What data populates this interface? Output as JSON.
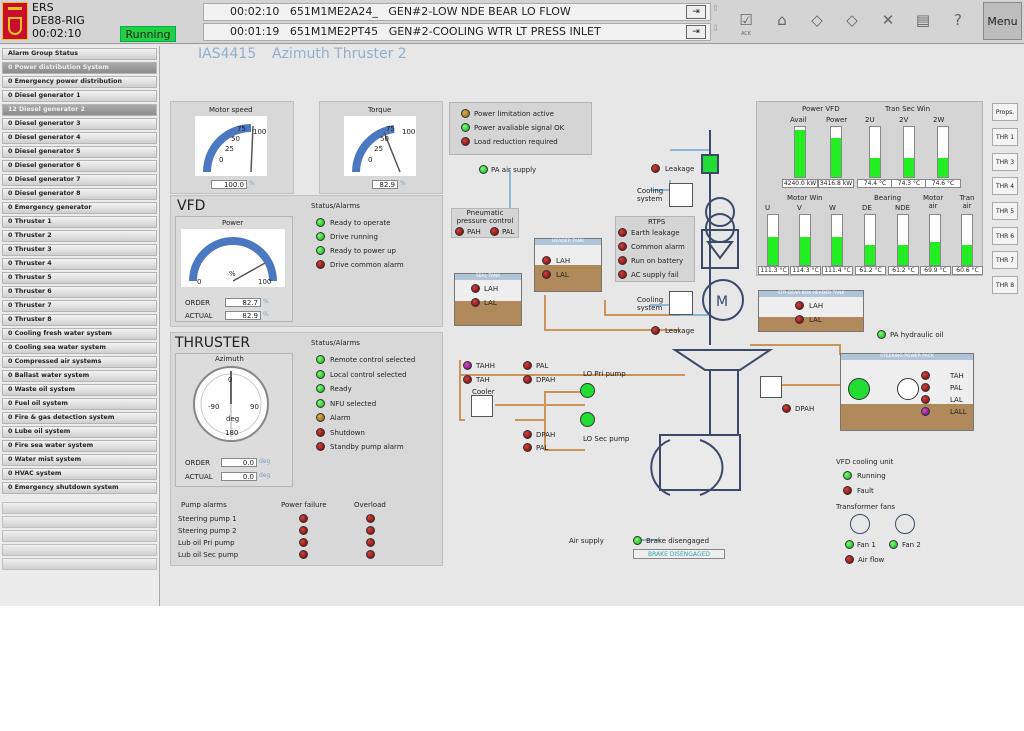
{
  "header": {
    "app_code": "ERS",
    "rig": "DE88-RIG",
    "clock": "00:02:10",
    "status": "Running",
    "alarms": [
      {
        "time": "00:02:10",
        "tag": "651M1ME2A24_",
        "text": "GEN#2-LOW NDE BEAR LO FLOW"
      },
      {
        "time": "00:01:19",
        "tag": "651M1ME2PT45",
        "text": "GEN#2-COOLING WTR LT PRESS INLET"
      }
    ],
    "ack_label": "ACK",
    "menu_label": "Menu",
    "icons": [
      "ack-icon",
      "home-icon",
      "back-icon",
      "forward-icon",
      "silence-icon",
      "print-icon",
      "help-icon"
    ]
  },
  "sidebar": {
    "title": "Alarm Group Status",
    "items": [
      {
        "label": "0 Power distribution System",
        "selected": true
      },
      {
        "label": "0 Emergency power distribution",
        "selected": false
      },
      {
        "label": "0 Diesel generator 1",
        "selected": false
      },
      {
        "label": "12 Diesel generator 2",
        "selected": true
      },
      {
        "label": "0 Diesel generator 3",
        "selected": false
      },
      {
        "label": "0 Diesel generator 4",
        "selected": false
      },
      {
        "label": "0 Diesel generator 5",
        "selected": false
      },
      {
        "label": "0 Diesel generator 6",
        "selected": false
      },
      {
        "label": "0 Diesel generator 7",
        "selected": false
      },
      {
        "label": "0 Diesel generator 8",
        "selected": false
      },
      {
        "label": "0 Emergency generator",
        "selected": false
      },
      {
        "label": "0 Thruster 1",
        "selected": false
      },
      {
        "label": "0 Thruster 2",
        "selected": false
      },
      {
        "label": "0 Thruster 3",
        "selected": false
      },
      {
        "label": "0 Thruster 4",
        "selected": false
      },
      {
        "label": "0 Thruster 5",
        "selected": false
      },
      {
        "label": "0 Thruster 6",
        "selected": false
      },
      {
        "label": "0 Thruster 7",
        "selected": false
      },
      {
        "label": "0 Thruster 8",
        "selected": false
      },
      {
        "label": "0 Cooling fresh water system",
        "selected": false
      },
      {
        "label": "0 Cooling sea water system",
        "selected": false
      },
      {
        "label": "0 Compressed air systems",
        "selected": false
      },
      {
        "label": "0 Ballast water system",
        "selected": false
      },
      {
        "label": "0 Waste oil system",
        "selected": false
      },
      {
        "label": "0 Fuel oil system",
        "selected": false
      },
      {
        "label": "0 Fire & gas detection system",
        "selected": false
      },
      {
        "label": "0 Lube oil system",
        "selected": false
      },
      {
        "label": "0 Fire sea water system",
        "selected": false
      },
      {
        "label": "0 Water mist system",
        "selected": false
      },
      {
        "label": "0 HVAC system",
        "selected": false
      },
      {
        "label": "0 Emergency shutdown system",
        "selected": false
      }
    ]
  },
  "page": {
    "id": "IAS4415",
    "title": "Azimuth Thruster 2"
  },
  "motor_speed": {
    "label": "Motor speed",
    "value": "100.0",
    "unit": "%",
    "ticks": [
      "0",
      "25",
      "50",
      "75",
      "100"
    ],
    "fraction": 1.0
  },
  "torque": {
    "label": "Torque",
    "value": "82.9",
    "unit": "%",
    "ticks": [
      "0",
      "25",
      "50",
      "75",
      "100"
    ],
    "fraction": 0.829
  },
  "power_status": [
    {
      "label": "Power limitation active",
      "color": "olive"
    },
    {
      "label": "Power avaliable signal OK",
      "color": "green"
    },
    {
      "label": "Load reduction required",
      "color": "red"
    }
  ],
  "vfd": {
    "title": "VFD",
    "gauge_label": "Power",
    "gauge_min": "0",
    "gauge_max": "100",
    "gauge_unit": "%",
    "fraction": 0.829,
    "order_label": "ORDER",
    "order_value": "82.7",
    "actual_label": "ACTUAL",
    "actual_value": "82.9",
    "unit": "%",
    "status_title": "Status/Alarms",
    "status": [
      {
        "label": "Ready to operate",
        "color": "green"
      },
      {
        "label": "Drive running",
        "color": "green"
      },
      {
        "label": "Ready to power up",
        "color": "green"
      },
      {
        "label": "Drive common alarm",
        "color": "red"
      }
    ]
  },
  "thruster": {
    "title": "THRUSTER",
    "gauge_label": "Azimuth",
    "dial_ticks": [
      "0",
      "90",
      "-90",
      "180"
    ],
    "dial_unit": "deg",
    "order_label": "ORDER",
    "order_value": "0.0",
    "actual_label": "ACTUAL",
    "actual_value": "0.0",
    "unit": "deg",
    "status_title": "Status/Alarms",
    "status": [
      {
        "label": "Remote control selected",
        "color": "green"
      },
      {
        "label": "Local control selected",
        "color": "green"
      },
      {
        "label": "Ready",
        "color": "green"
      },
      {
        "label": "NFU selected",
        "color": "green"
      },
      {
        "label": "Alarm",
        "color": "olive"
      },
      {
        "label": "Shutdown",
        "color": "red"
      },
      {
        "label": "Standby pump alarm",
        "color": "red"
      }
    ]
  },
  "pump_alarms": {
    "title": "Pump alarms",
    "col1": "Power failure",
    "col2": "Overload",
    "rows": [
      "Steering pump 1",
      "Steering pump 2",
      "Lub oil Pri pump",
      "Lub oil Sec pump"
    ]
  },
  "bars": {
    "power_title": "Power VFD",
    "tran_sec_title": "Tran Sec Win",
    "motor_win_title": "Motor Win",
    "bearing_title": "Bearing",
    "motor_air_title": "Motor air",
    "tran_air_title": "Tran air",
    "top": [
      {
        "label": "Avail",
        "value": "4240.0 kW",
        "fraction": 0.95
      },
      {
        "label": "Power",
        "value": "3416.8 kW",
        "fraction": 0.78
      },
      {
        "label": "2U",
        "value": "74.4 °C",
        "fraction": 0.38
      },
      {
        "label": "2V",
        "value": "74.3 °C",
        "fraction": 0.38
      },
      {
        "label": "2W",
        "value": "74.6 °C",
        "fraction": 0.38
      }
    ],
    "bottom": [
      {
        "label": "U",
        "value": "111.3 °C",
        "fraction": 0.56
      },
      {
        "label": "V",
        "value": "114.3 °C",
        "fraction": 0.57
      },
      {
        "label": "W",
        "value": "111.4 °C",
        "fraction": 0.56
      },
      {
        "label": "DE",
        "value": "61.2 °C",
        "fraction": 0.4
      },
      {
        "label": "NDE",
        "value": "61.2 °C",
        "fraction": 0.4
      },
      {
        "label": "",
        "value": "69.9 °C",
        "fraction": 0.46
      },
      {
        "label": "",
        "value": "60.6 °C",
        "fraction": 0.4
      }
    ]
  },
  "side_buttons": [
    "Props.",
    "THR 1",
    "THR 3",
    "THR 4",
    "THR 5",
    "THR 6",
    "THR 7",
    "THR 8"
  ],
  "diagram": {
    "pa_air": "PA air supply",
    "pneumatic": "Pneumatic pressure control",
    "pah": "PAH",
    "pal": "PAL",
    "seal_tank": "SEAL TANK",
    "header_tank": "HEADER TANK",
    "lah": "LAH",
    "lal": "LAL",
    "leakage": "Leakage",
    "cooling": "Cooling system",
    "rtps": "RTPS",
    "rtps_items": [
      "Earth leakage",
      "Common alarm",
      "Run on battery",
      "AC supply fail"
    ],
    "str_gear_tank": "STR GEAR BOX HEADER TANK",
    "pa_hydraulic": "PA hydraulic oil",
    "steering_pack": "STEERING POWER PACK",
    "steer_alarms": [
      {
        "label": "TAH",
        "color": "red"
      },
      {
        "label": "PAL",
        "color": "red"
      },
      {
        "label": "LAL",
        "color": "red"
      },
      {
        "label": "LALL",
        "color": "purple"
      }
    ],
    "dpah": "DPAH",
    "tahh": "TAHH",
    "tah": "TAH",
    "cooler": "Cooler",
    "lo_pri": "LO Pri pump",
    "lo_sec": "LO Sec pump",
    "motor_symbol": "M",
    "vfd_cooling": "VFD cooling unit",
    "running": "Running",
    "fault": "Fault",
    "transformer_fans": "Transformer fans",
    "fan1": "Fan 1",
    "fan2": "Fan 2",
    "air_flow": "Air flow",
    "air_supply": "Air supply",
    "brake": "Brake disengaged",
    "brake_status": "BRAKE DISENGAGED"
  }
}
